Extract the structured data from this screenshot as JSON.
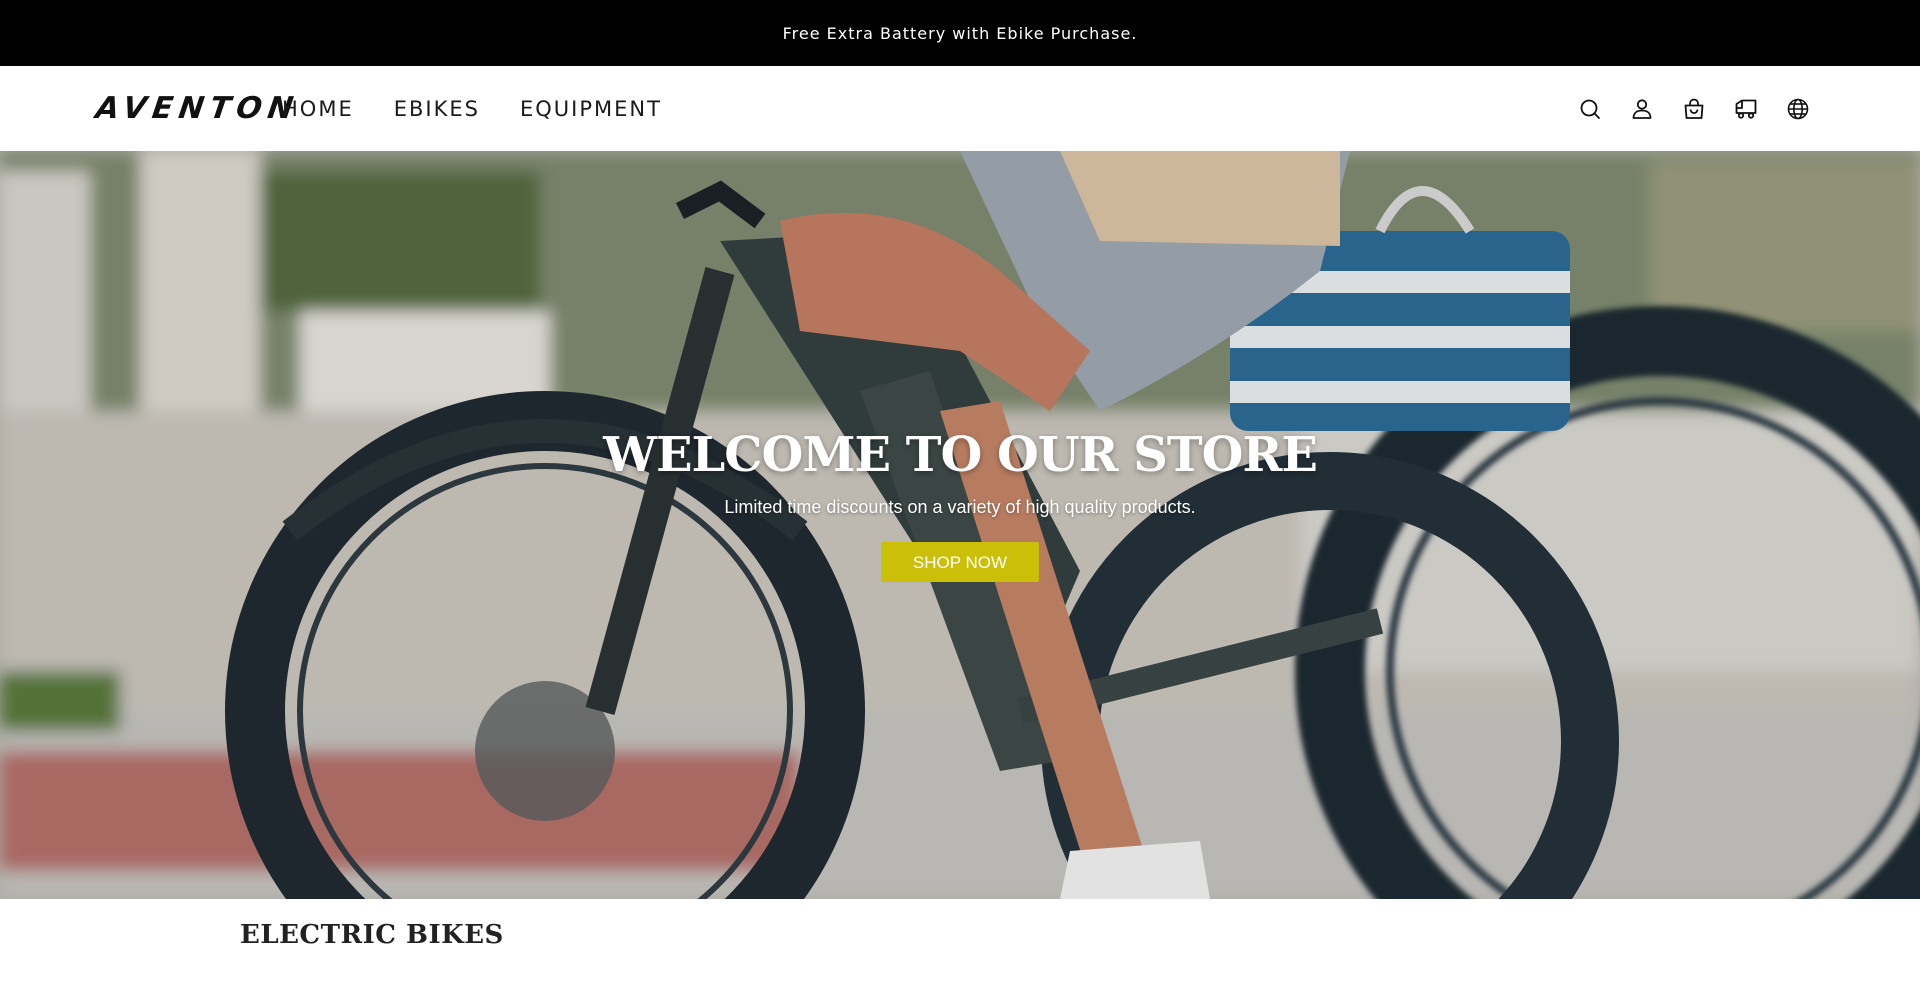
{
  "announcement": {
    "text": "Free Extra Battery with Ebike Purchase."
  },
  "header": {
    "logo_text": "AVENTON",
    "nav": [
      {
        "label": "HOME"
      },
      {
        "label": "EBIKES"
      },
      {
        "label": "EQUIPMENT"
      }
    ],
    "icons": [
      "search-icon",
      "account-icon",
      "cart-icon",
      "delivery-icon",
      "globe-icon"
    ]
  },
  "hero": {
    "title": "WELCOME TO OUR STORE",
    "subtitle": "Limited time discounts on a variety of high quality products.",
    "cta_label": "SHOP NOW",
    "cta_color": "#cbbf0a"
  },
  "section": {
    "title": "ELECTRIC BIKES"
  }
}
